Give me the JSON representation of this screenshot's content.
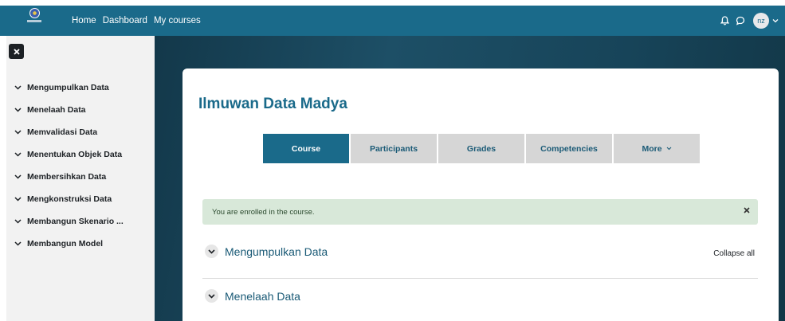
{
  "navbar": {
    "links": [
      "Home",
      "Dashboard",
      "My courses"
    ],
    "avatar_initials": "nz",
    "icons": [
      "bell-icon",
      "chat-icon",
      "chevron-down-icon"
    ],
    "color": "#1a6a8a"
  },
  "drawer": {
    "close_icon": "close-icon",
    "items": [
      "Mengumpulkan Data",
      "Menelaah Data",
      "Memvalidasi Data",
      "Menentukan Objek Data",
      "Membersihkan Data",
      "Mengkonstruksi Data",
      "Membangun Skenario ...",
      "Membangun Model"
    ]
  },
  "course": {
    "title": "Ilmuwan Data Madya",
    "tabs": [
      "Course",
      "Participants",
      "Grades",
      "Competencies",
      "More"
    ],
    "active_tab": "Course",
    "alert": "You are enrolled in the course.",
    "collapse_all": "Collapse all",
    "sections": [
      "Mengumpulkan Data",
      "Menelaah Data"
    ]
  },
  "colors": {
    "accent": "#1a6a8a",
    "alert_bg": "#d8e8d9"
  }
}
